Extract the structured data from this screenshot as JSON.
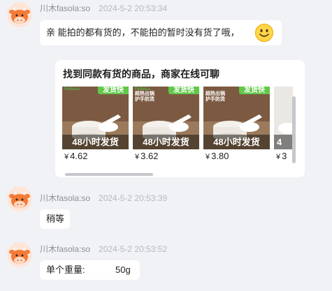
{
  "messages": [
    {
      "sender": "川木fasola:so",
      "time": "2024-5-2 20:53:34",
      "text": "亲 能拍的都有货的，不能拍的暂时没有货了哦，",
      "emoji": "smile-emoji-icon"
    },
    {
      "sender": "川木fasola:so",
      "time": "2024-5-2 20:53:39",
      "text": "稍等"
    },
    {
      "sender": "川木fasola:so",
      "time": "2024-5-2 20:53:52",
      "label": "单个重量:",
      "value": "50g"
    }
  ],
  "card": {
    "title": "找到同款有货的商品，商家在线可聊",
    "products": [
      {
        "brand": "FaSoLa",
        "features": "",
        "tag": "发货快",
        "badge": "48小时发货",
        "currency": "¥",
        "price": "4.62"
      },
      {
        "brand": "FaSoLa",
        "features": "超热出锅 护手防烫",
        "tag": "发货快",
        "badge": "48小时发货",
        "currency": "¥",
        "price": "3.62"
      },
      {
        "brand": "",
        "features": "超热出锅 护手防烫",
        "tag": "发货快",
        "badge": "48小时发货",
        "currency": "¥",
        "price": "3.80"
      },
      {
        "brand": "",
        "features": "",
        "tag": "",
        "badge": "4",
        "currency": "¥",
        "price": "3"
      }
    ]
  },
  "colors": {
    "background": "#f1f2f6",
    "bubble": "#ffffff",
    "tag_green": "#62c84a",
    "meta_gray": "#8e8e96"
  }
}
